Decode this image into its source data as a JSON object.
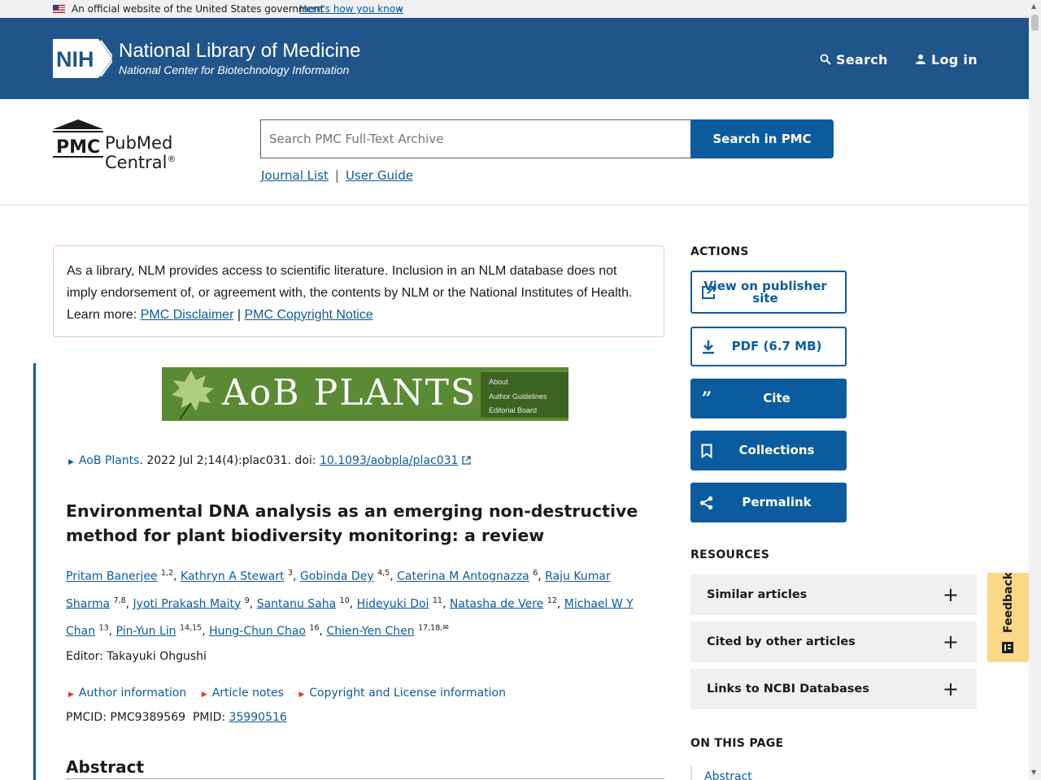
{
  "gov_banner": {
    "official_text": "An official website of the United States government",
    "howto_link": "Here's how you know",
    "chevron_icon": "chevron-down-icon"
  },
  "nih_header": {
    "logo_text": "NIH",
    "title": "National Library of Medicine",
    "subtitle": "National Center for Biotechnology Information",
    "search_label": "Search",
    "login_label": "Log in"
  },
  "pmc": {
    "logo_abbrev": "PMC",
    "logo_name": "PubMed Central",
    "logo_reg": "®",
    "search_placeholder": "Search PMC Full-Text Archive",
    "search_button": "Search in PMC",
    "journal_list": "Journal List",
    "separator": "|",
    "user_guide": "User Guide"
  },
  "disclaimer": {
    "text": "As a library, NLM provides access to scientific literature. Inclusion in an NLM database does not imply endorsement of, or agreement with, the contents by NLM or the National Institutes of Health. Learn more: ",
    "link1": "PMC Disclaimer",
    "sep": " | ",
    "link2": "PMC Copyright Notice"
  },
  "journal_banner": {
    "name": "AoB PLANTS",
    "menu": [
      "About",
      "Author Guidelines",
      "Editorial Board"
    ],
    "brand_color": "#5b8a34"
  },
  "citation": {
    "journal": "AoB Plants",
    "details": ". 2022 Jul 2;14(4):plac031. doi: ",
    "doi": "10.1093/aobpla/plac031"
  },
  "article": {
    "title": "Environmental DNA analysis as an emerging non-destructive method for plant biodiversity monitoring: a review",
    "authors": [
      {
        "name": "Pritam Banerjee",
        "sup": "1,2"
      },
      {
        "name": "Kathryn A Stewart",
        "sup": "3"
      },
      {
        "name": "Gobinda Dey",
        "sup": "4,5"
      },
      {
        "name": "Caterina M Antognazza",
        "sup": "6"
      },
      {
        "name": "Raju Kumar Sharma",
        "sup": "7,8"
      },
      {
        "name": "Jyoti Prakash Maity",
        "sup": "9"
      },
      {
        "name": "Santanu Saha",
        "sup": "10"
      },
      {
        "name": "Hideyuki Doi",
        "sup": "11"
      },
      {
        "name": "Natasha de Vere",
        "sup": "12"
      },
      {
        "name": "Michael W Y Chan",
        "sup": "13"
      },
      {
        "name": "Pin-Yun Lin",
        "sup": "14,15"
      },
      {
        "name": "Hung-Chun Chao",
        "sup": "16"
      },
      {
        "name": "Chien-Yen Chen",
        "sup": "17,18,"
      }
    ],
    "editor": "Editor: Takayuki Ohgushi",
    "meta_links": [
      "Author information",
      "Article notes",
      "Copyright and License information"
    ],
    "pmcid_label": "PMCID: PMC9389569",
    "pmid_label": "PMID: ",
    "pmid": "35990516",
    "abstract_heading": "Abstract"
  },
  "sidebar": {
    "actions_heading": "ACTIONS",
    "actions": [
      {
        "label": "View on publisher site",
        "icon": "external-link-icon",
        "style": "outline"
      },
      {
        "label": "PDF (6.7 MB)",
        "icon": "download-icon",
        "style": "outline"
      },
      {
        "label": "Cite",
        "icon": "quote-icon",
        "style": "solid"
      },
      {
        "label": "Collections",
        "icon": "bookmark-icon",
        "style": "solid"
      },
      {
        "label": "Permalink",
        "icon": "share-icon",
        "style": "solid"
      }
    ],
    "resources_heading": "RESOURCES",
    "resources": [
      "Similar articles",
      "Cited by other articles",
      "Links to NCBI Databases"
    ],
    "on_this_page_heading": "ON THIS PAGE",
    "on_this_page": [
      "Abstract"
    ]
  },
  "feedback": {
    "label": "Feedback"
  },
  "colors": {
    "nih_blue": "#20558a",
    "pmc_blue": "#0b5c9e",
    "feedback_bg": "#f9d985"
  }
}
